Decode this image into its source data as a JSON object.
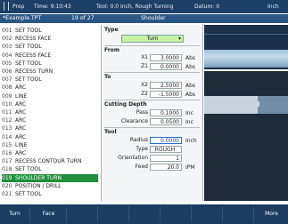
{
  "topbar": {
    "title": "Prep",
    "time": "Time: 9:10:43",
    "tool": "Tool: 0.0 Inch, Rough Turning",
    "datum": "Datum: 0",
    "units": "Inch"
  },
  "header": {
    "file": "*Example.TPT",
    "position": "19 of 27",
    "mode": "Shoulder"
  },
  "program": [
    {
      "n": "001",
      "label": "SET TOOL"
    },
    {
      "n": "002",
      "label": "RECESS FACE"
    },
    {
      "n": "003",
      "label": "SET TOOL"
    },
    {
      "n": "004",
      "label": "RECESS FACE"
    },
    {
      "n": "005",
      "label": "SET TOOL"
    },
    {
      "n": "006",
      "label": "RECESS TURN"
    },
    {
      "n": "007",
      "label": "SET TOOL"
    },
    {
      "n": "008",
      "label": "ARC"
    },
    {
      "n": "009",
      "label": "LINE"
    },
    {
      "n": "010",
      "label": "ARC"
    },
    {
      "n": "011",
      "label": "ARC"
    },
    {
      "n": "012",
      "label": "ARC"
    },
    {
      "n": "013",
      "label": "ARC"
    },
    {
      "n": "014",
      "label": "ARC"
    },
    {
      "n": "015",
      "label": "LINE"
    },
    {
      "n": "016",
      "label": "ARC"
    },
    {
      "n": "017",
      "label": "RECESS CONTOUR TURN"
    },
    {
      "n": "018",
      "label": "SET TOOL"
    },
    {
      "n": "019",
      "label": "SHOULDER TURN"
    },
    {
      "n": "020",
      "label": "POSITION / DRILL"
    },
    {
      "n": "021",
      "label": "SET TOOL"
    }
  ],
  "form": {
    "type_label": "Type",
    "type_value": "Turn",
    "from_label": "From",
    "to_label": "To",
    "depth_label": "Cutting Depth",
    "tool_label": "Tool",
    "x1": {
      "label": "X1",
      "value": "3.0000",
      "unit": "Abs"
    },
    "z1": {
      "label": "Z1",
      "value": "0.0000",
      "unit": "Abs"
    },
    "x2": {
      "label": "X2",
      "value": "2.5000",
      "unit": "Abs"
    },
    "z2": {
      "label": "Z2",
      "value": "-1.5000",
      "unit": "Abs"
    },
    "pass": {
      "label": "Pass",
      "value": "0.1000",
      "unit": "Inc"
    },
    "clearance": {
      "label": "Clearance",
      "value": "0.0500",
      "unit": "Inc"
    },
    "radius": {
      "label": "Radius",
      "value": "0.0000",
      "unit": "Inch"
    },
    "tooltype": {
      "label": "Type",
      "value": "ROUGH"
    },
    "orientation": {
      "label": "Orientation",
      "value": "1"
    },
    "feed": {
      "label": "Feed",
      "value": "20.0",
      "unit": "IPM"
    }
  },
  "softkeys": {
    "k1": "Turn",
    "k2": "Face",
    "k8": "More"
  }
}
